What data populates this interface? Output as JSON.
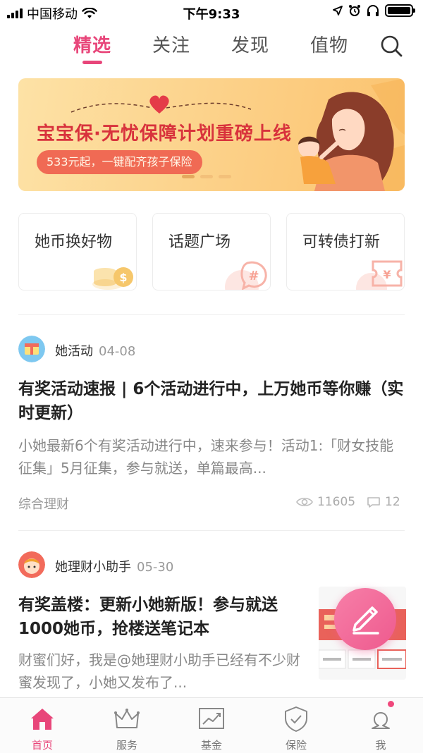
{
  "status_bar": {
    "carrier": "中国移动",
    "time": "下午9:33"
  },
  "tabs": [
    {
      "label": "精选",
      "active": true
    },
    {
      "label": "关注"
    },
    {
      "label": "发现"
    },
    {
      "label": "值物"
    }
  ],
  "banner": {
    "title": "宝宝保·无忧保障计划重磅上线",
    "subtitle": "533元起，一键配齐孩子保险"
  },
  "shortcuts": [
    {
      "label": "她币换好物",
      "icon": "coins-icon"
    },
    {
      "label": "话题广场",
      "icon": "hashtag-bubble-icon"
    },
    {
      "label": "可转债打新",
      "icon": "yen-ticket-icon"
    }
  ],
  "posts": [
    {
      "author": "她活动",
      "date": "04-08",
      "title": "有奖活动速报 | 6个活动进行中，上万她币等你赚（实时更新）",
      "excerpt": "小她最新6个有奖活动进行中，速来参与！活动1:「财女技能征集」5月征集，参与就送，单篇最高...",
      "category": "综合理财",
      "views": "11605",
      "comments": "12"
    },
    {
      "author": "她理财小助手",
      "date": "05-30",
      "title": "有奖盖楼：更新小她新版！参与就送1000她币，抢楼送笔记本",
      "excerpt": "财蜜们好，我是@她理财小助手已经有不少财蜜发现了，小她又发布了..."
    }
  ],
  "bottom_nav": [
    {
      "label": "首页",
      "icon": "home-icon",
      "active": true
    },
    {
      "label": "服务",
      "icon": "crown-icon"
    },
    {
      "label": "基金",
      "icon": "chart-icon"
    },
    {
      "label": "保险",
      "icon": "shield-icon"
    },
    {
      "label": "我",
      "icon": "profile-icon"
    }
  ],
  "colors": {
    "accent": "#e8467a",
    "banner_title": "#d8323c",
    "banner_sub_bg": "#f06a54"
  }
}
